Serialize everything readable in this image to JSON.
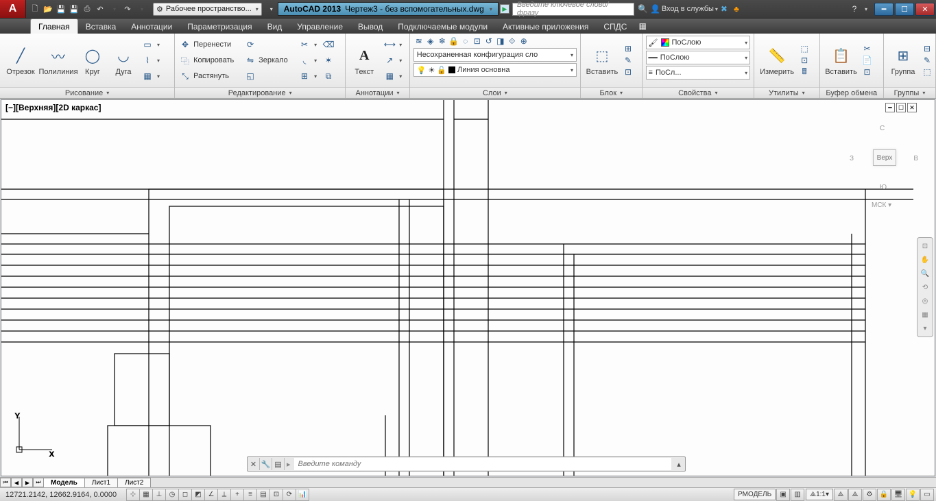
{
  "titlebar": {
    "workspace_label": "Рабочее пространство...",
    "app_name": "AutoCAD 2013",
    "doc_name": "Чертеж3 - без вспомогательных.dwg",
    "search_placeholder": "Введите ключевое слово/фразу",
    "signin_label": "Вход в службы"
  },
  "ribbon": {
    "tabs": [
      "Главная",
      "Вставка",
      "Аннотации",
      "Параметризация",
      "Вид",
      "Управление",
      "Вывод",
      "Подключаемые модули",
      "Активные приложения",
      "СПДС"
    ],
    "active_tab": 0,
    "panels": {
      "draw": {
        "title": "Рисование",
        "line": "Отрезок",
        "polyline": "Полилиния",
        "circle": "Круг",
        "arc": "Дуга"
      },
      "edit": {
        "title": "Редактирование",
        "move": "Перенести",
        "copy": "Копировать",
        "stretch": "Растянуть",
        "rotate": "",
        "mirror": "Зеркало",
        "scale": ""
      },
      "annot": {
        "title": "Аннотации",
        "text": "Текст"
      },
      "layers": {
        "title": "Слои",
        "unsaved_config": "Несохраненная конфигурация сло",
        "current_layer": "Линия основна"
      },
      "block": {
        "title": "Блок",
        "insert": "Вставить"
      },
      "props": {
        "title": "Свойства",
        "color": "ПоСлою",
        "ltype": "ПоСлою",
        "lweight": "ПоСл..."
      },
      "util": {
        "title": "Утилиты",
        "measure": "Измерить"
      },
      "clip": {
        "title": "Буфер обмена",
        "paste": "Вставить"
      },
      "group": {
        "title": "Группы",
        "group": "Группа"
      }
    }
  },
  "canvas": {
    "view_label": "[−][Верхняя][2D каркас]",
    "viewcube": {
      "n": "С",
      "s": "Ю",
      "e": "В",
      "w": "З",
      "top": "Верх",
      "wcs": "МСК"
    }
  },
  "cmd": {
    "placeholder": "Введите команду"
  },
  "layout_tabs": {
    "model": "Модель",
    "sheets": [
      "Лист1",
      "Лист2"
    ]
  },
  "status": {
    "coords": "12721.2142, 12662.9164, 0.0000",
    "model_btn": "РМОДЕЛЬ",
    "scale": "1:1"
  }
}
